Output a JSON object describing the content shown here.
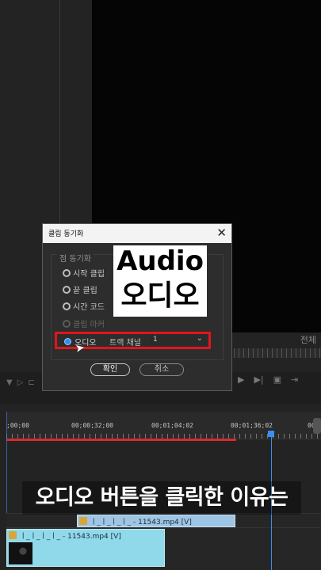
{
  "dialog": {
    "title": "클립 동기화",
    "close_glyph": "✕",
    "group_label": "점 동기화",
    "options": [
      "시작 클립",
      "끝 클립",
      "시간 코드",
      "클립 마커"
    ],
    "audio_option": "오디오",
    "track_channel_label": "트랙 채널",
    "track_channel_value": "1",
    "ok_label": "확인",
    "cancel_label": "취소"
  },
  "overlay": {
    "english": "Audio",
    "korean": "오디오"
  },
  "monitor": {
    "fit_label": "전체"
  },
  "timeline": {
    "ticks": [
      ";00;00",
      "00;00;32;00",
      "00;01;04;02",
      "00;01;36;02",
      "00;0"
    ],
    "clip_top_name": "ㅣ_ㅣ_ㅣ_ㅣ_ - 11543.mp4 [V]",
    "clip_main_name": "ㅣ_ㅣ_ㅣ_ㅣ_ - 11543.mp4 [V]"
  },
  "caption": "오디오 버튼을 클릭한 이유는",
  "colors": {
    "highlight_red": "#e0161b",
    "playhead_blue": "#3d8ef0",
    "clip_cyan": "#8fd9ea"
  }
}
